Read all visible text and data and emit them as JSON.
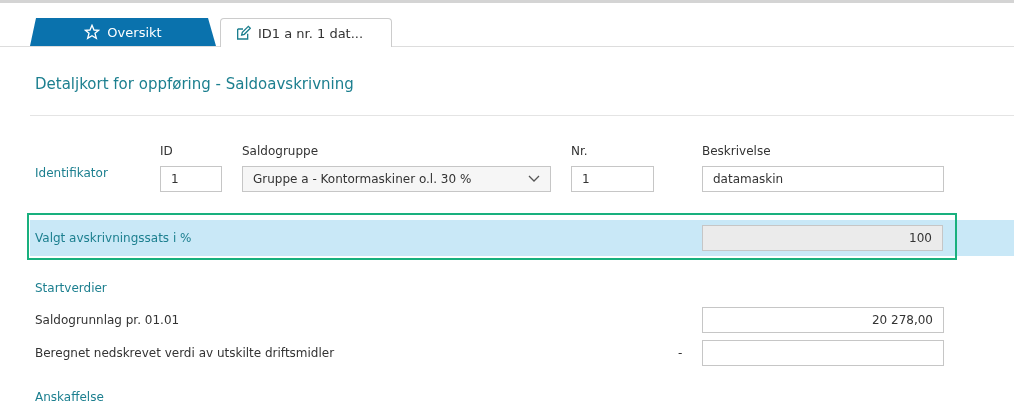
{
  "tabs": [
    {
      "label": "Oversikt",
      "kind": "overview",
      "selected": true
    },
    {
      "label": "ID1 a nr. 1 dat...",
      "kind": "document",
      "selected": false
    }
  ],
  "title": "Detaljkort for oppføring - Saldoavskrivning",
  "identifier": {
    "label": "Identifikator",
    "fields": [
      {
        "kind": "input",
        "label": "ID",
        "value": "1"
      },
      {
        "kind": "select",
        "label": "Saldogruppe",
        "value": "Gruppe a - Kontormaskiner o.l. 30 %"
      },
      {
        "kind": "input",
        "label": "Nr.",
        "value": "1"
      },
      {
        "kind": "input",
        "label": "Beskrivelse",
        "value": "datamaskin"
      }
    ]
  },
  "rate_row": {
    "label": "Valgt avskrivningssats i %",
    "value": "100",
    "highlighted": true,
    "readonly": true
  },
  "sections": [
    {
      "title": "Startverdier",
      "rows": [
        {
          "label": "Saldogrunnlag pr. 01.01",
          "value": "20 278,00"
        },
        {
          "label": "Beregnet nedskrevet verdi av utskilte driftsmidler",
          "sign": "-",
          "value": ""
        }
      ]
    },
    {
      "title": "Anskaffelse"
    }
  ]
}
